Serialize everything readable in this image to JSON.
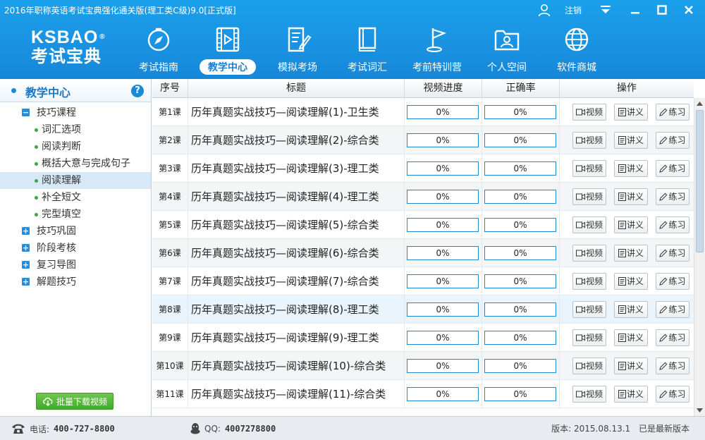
{
  "window": {
    "title": "2016年职称英语考试宝典强化通关版(理工类C级)9.0[正式版]",
    "logout": "注销"
  },
  "brand": {
    "en": "KSBAO",
    "reg": "®",
    "cn": "考试宝典"
  },
  "nav": [
    {
      "label": "考试指南",
      "icon": "compass-icon"
    },
    {
      "label": "教学中心",
      "icon": "video-icon",
      "active": true
    },
    {
      "label": "模拟考场",
      "icon": "exam-paper-icon"
    },
    {
      "label": "考试词汇",
      "icon": "book-icon"
    },
    {
      "label": "考前特训营",
      "icon": "flag-icon"
    },
    {
      "label": "个人空间",
      "icon": "user-folder-icon"
    },
    {
      "label": "软件商城",
      "icon": "globe-icon"
    }
  ],
  "sidebar": {
    "title": "教学中心",
    "help": "?",
    "tree": [
      {
        "label": "技巧课程",
        "type": "group",
        "expanded": true
      },
      {
        "label": "词汇选项",
        "type": "leaf"
      },
      {
        "label": "阅读判断",
        "type": "leaf"
      },
      {
        "label": "概括大意与完成句子",
        "type": "leaf"
      },
      {
        "label": "阅读理解",
        "type": "leaf",
        "selected": true
      },
      {
        "label": "补全短文",
        "type": "leaf"
      },
      {
        "label": "完型填空",
        "type": "leaf"
      },
      {
        "label": "技巧巩固",
        "type": "group",
        "expanded": false
      },
      {
        "label": "阶段考核",
        "type": "group",
        "expanded": false
      },
      {
        "label": "复习导图",
        "type": "group",
        "expanded": false
      },
      {
        "label": "解题技巧",
        "type": "group",
        "expanded": false
      }
    ],
    "download_button": "批量下载视频"
  },
  "table": {
    "headers": {
      "no": "序号",
      "title": "标题",
      "progress": "视频进度",
      "accuracy": "正确率",
      "ops": "操作"
    },
    "op_labels": {
      "video": "视频",
      "notes": "讲义",
      "practice": "练习"
    },
    "rows": [
      {
        "no": "第1课",
        "title": "历年真题实战技巧—阅读理解(1)-卫生类",
        "progress": "0%",
        "accuracy": "0%"
      },
      {
        "no": "第2课",
        "title": "历年真题实战技巧—阅读理解(2)-综合类",
        "progress": "0%",
        "accuracy": "0%"
      },
      {
        "no": "第3课",
        "title": "历年真题实战技巧—阅读理解(3)-理工类",
        "progress": "0%",
        "accuracy": "0%"
      },
      {
        "no": "第4课",
        "title": "历年真题实战技巧—阅读理解(4)-理工类",
        "progress": "0%",
        "accuracy": "0%"
      },
      {
        "no": "第5课",
        "title": "历年真题实战技巧—阅读理解(5)-综合类",
        "progress": "0%",
        "accuracy": "0%"
      },
      {
        "no": "第6课",
        "title": "历年真题实战技巧—阅读理解(6)-综合类",
        "progress": "0%",
        "accuracy": "0%"
      },
      {
        "no": "第7课",
        "title": "历年真题实战技巧—阅读理解(7)-综合类",
        "progress": "0%",
        "accuracy": "0%"
      },
      {
        "no": "第8课",
        "title": "历年真题实战技巧—阅读理解(8)-理工类",
        "progress": "0%",
        "accuracy": "0%"
      },
      {
        "no": "第9课",
        "title": "历年真题实战技巧—阅读理解(9)-理工类",
        "progress": "0%",
        "accuracy": "0%"
      },
      {
        "no": "第10课",
        "title": "历年真题实战技巧—阅读理解(10)-综合类",
        "progress": "0%",
        "accuracy": "0%"
      },
      {
        "no": "第11课",
        "title": "历年真题实战技巧—阅读理解(11)-综合类",
        "progress": "0%",
        "accuracy": "0%"
      }
    ]
  },
  "status": {
    "phone_label": "电话:",
    "phone": "400-727-8800",
    "qq_label": "QQ:",
    "qq": "4007278800",
    "version_label": "版本:",
    "version": "2015.08.13.1",
    "update_status": "已是最新版本"
  },
  "colors": {
    "header_blue": "#1a93e2",
    "accent": "#1a88d6",
    "download_green": "#45a82c"
  }
}
